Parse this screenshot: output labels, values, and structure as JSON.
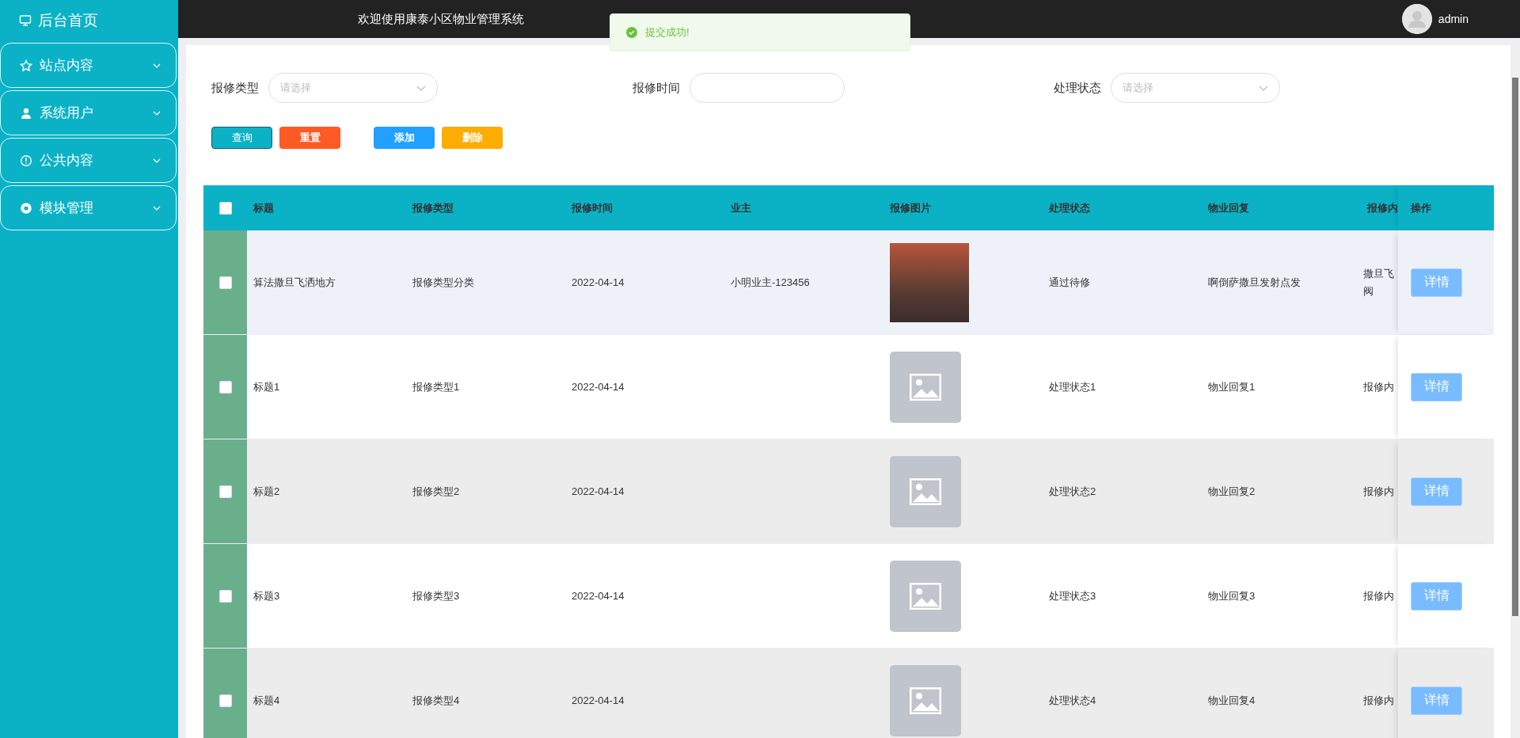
{
  "sidebar": {
    "home": {
      "label": "后台首页"
    },
    "items": [
      {
        "label": "站点内容",
        "kind": "star",
        "expanded": false
      },
      {
        "label": "系统用户",
        "kind": "user",
        "expanded": false
      },
      {
        "label": "公共内容",
        "kind": "info",
        "expanded": false
      },
      {
        "label": "模块管理",
        "kind": "module",
        "expanded": false
      }
    ]
  },
  "header": {
    "title": "欢迎使用康泰小区物业管理系统",
    "user": "admin"
  },
  "toast": {
    "message": "提交成功!"
  },
  "filters": [
    {
      "label": "报修类型",
      "kind": "select",
      "placeholder": "请选择"
    },
    {
      "label": "报修时间",
      "kind": "date"
    },
    {
      "label": "处理状态",
      "kind": "select",
      "placeholder": "请选择"
    }
  ],
  "buttons": [
    {
      "label": "查询",
      "kind": "query"
    },
    {
      "label": "重置",
      "kind": "reset"
    },
    {
      "label": "添加",
      "kind": "add"
    },
    {
      "label": "删除",
      "kind": "delete"
    }
  ],
  "table": {
    "select_all_checked": false,
    "columns": [
      "标题",
      "报修类型",
      "报修时间",
      "业主",
      "报修图片",
      "处理状态",
      "物业回复",
      "报修内",
      "操作"
    ],
    "rows": [
      {
        "checked": false,
        "hovered": true,
        "title": "算法撒旦飞洒地方",
        "type": "报修类型分类",
        "time": "2022-04-14",
        "owner": "小明业主-123456",
        "kind": "photo",
        "status": "通过待修",
        "reply": "啊倒萨撒旦发射点发",
        "content": "撒旦飞阀",
        "action": "详情"
      },
      {
        "checked": false,
        "hovered": false,
        "title": "标题1",
        "type": "报修类型1",
        "time": "2022-04-14",
        "kind": "placeholder",
        "status": "处理状态1",
        "reply": "物业回复1",
        "content": "报修内",
        "action": "详情"
      },
      {
        "checked": false,
        "hovered": false,
        "title": "标题2",
        "type": "报修类型2",
        "time": "2022-04-14",
        "kind": "placeholder",
        "status": "处理状态2",
        "reply": "物业回复2",
        "content": "报修内",
        "action": "详情"
      },
      {
        "checked": false,
        "hovered": false,
        "title": "标题3",
        "type": "报修类型3",
        "time": "2022-04-14",
        "kind": "placeholder",
        "status": "处理状态3",
        "reply": "物业回复3",
        "content": "报修内",
        "action": "详情"
      },
      {
        "checked": false,
        "hovered": false,
        "title": "标题4",
        "type": "报修类型4",
        "time": "2022-04-14",
        "kind": "placeholder",
        "status": "处理状态4",
        "reply": "物业回复4",
        "content": "报修内",
        "action": "详情"
      }
    ]
  }
}
